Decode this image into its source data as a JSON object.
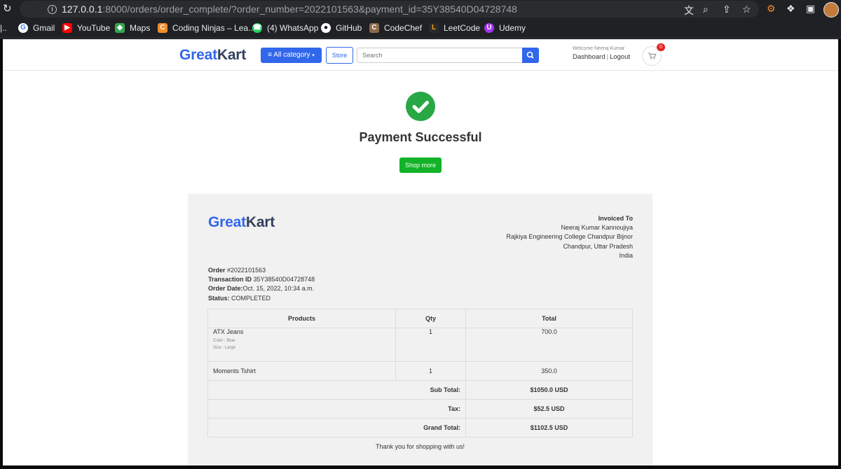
{
  "browser": {
    "url_host": "127.0.0.1",
    "url_rest": ":8000/orders/order_complete/?order_number=2022101563&payment_id=35Y38540D04728748",
    "bookmarks": [
      {
        "label": "Gmail",
        "icon": "gmail-icon",
        "color": "#ffffff"
      },
      {
        "label": "YouTube",
        "icon": "youtube-icon",
        "color": "#ff0000"
      },
      {
        "label": "Maps",
        "icon": "maps-icon",
        "color": "#34a853"
      },
      {
        "label": "Coding Ninjas – Lea...",
        "icon": "coding-ninjas-icon",
        "color": "#f28c28"
      },
      {
        "label": "(4) WhatsApp",
        "icon": "whatsapp-icon",
        "color": "#25d366"
      },
      {
        "label": "GitHub",
        "icon": "github-icon",
        "color": "#ffffff"
      },
      {
        "label": "CodeChef",
        "icon": "codechef-icon",
        "color": "#8b6b4a"
      },
      {
        "label": "LeetCode",
        "icon": "leetcode-icon",
        "color": "#ffa116"
      },
      {
        "label": "Udemy",
        "icon": "udemy-icon",
        "color": "#a435f0"
      }
    ]
  },
  "brand": {
    "part1": "Great",
    "part2": "Kart",
    "primary_color": "#3167eb",
    "dark_color": "#323f5c"
  },
  "nav": {
    "category_label": "All category",
    "store_label": "Store",
    "search_placeholder": "Search",
    "welcome": "Welcome Neeraj Kumar",
    "dashboard_label": "Dashboard",
    "logout_label": "Logout",
    "cart_count": "0"
  },
  "result": {
    "title": "Payment Successful",
    "button_label": "Shop more",
    "success_color": "#28a745"
  },
  "invoice": {
    "invoiced_to_label": "Invoiced To",
    "address_lines": [
      "Neeraj Kumar Kannoujiya",
      "Rajkiya Engineering College Chandpur Bijnor",
      "Chandpur, Uttar Pradesh",
      "India"
    ],
    "order_label": "Order",
    "order_number": "#2022101563",
    "transaction_label": "Transaction ID",
    "transaction_id": "35Y38540D04728748",
    "date_label": "Order Date:",
    "date": "Oct. 15, 2022, 10:34 a.m.",
    "status_label": "Status:",
    "status": "COMPLETED",
    "columns": [
      "Products",
      "Qty",
      "Total"
    ],
    "items": [
      {
        "name": "ATX Jeans",
        "color": "Color : Blue",
        "size": "Size : Large",
        "qty": "1",
        "total": "700.0"
      },
      {
        "name": "Moments Tshirt",
        "qty": "1",
        "total": "350.0"
      }
    ],
    "subtotal_label": "Sub Total:",
    "subtotal": "$1050.0 USD",
    "tax_label": "Tax:",
    "tax": "$52.5 USD",
    "grand_label": "Grand Total:",
    "grand": "$1102.5 USD",
    "thanks": "Thank you for shopping with us!"
  }
}
